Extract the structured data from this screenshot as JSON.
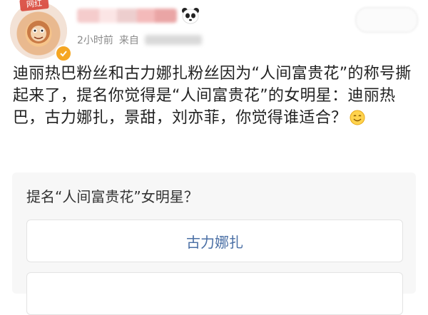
{
  "header": {
    "avatar_tag": "网红",
    "time": "2小时前",
    "source_prefix": "来自"
  },
  "post": {
    "text": "迪丽热巴粉丝和古力娜扎粉丝因为“人间富贵花”的称号撕起来了，提名你觉得是“人间富贵花”的女明星：迪丽热巴，古力娜扎，景甜，刘亦菲，你觉得谁适合？"
  },
  "poll": {
    "question": "提名“人间富贵花”女明星？",
    "options": [
      {
        "label": "古力娜扎"
      },
      {
        "label": ""
      }
    ]
  },
  "colors": {
    "badge": "#f5a623",
    "option_text": "#4a6fa5",
    "meta": "#8a8a8a"
  },
  "icons": [
    "verified-badge-icon",
    "panda-icon",
    "smile-emoji-icon"
  ]
}
